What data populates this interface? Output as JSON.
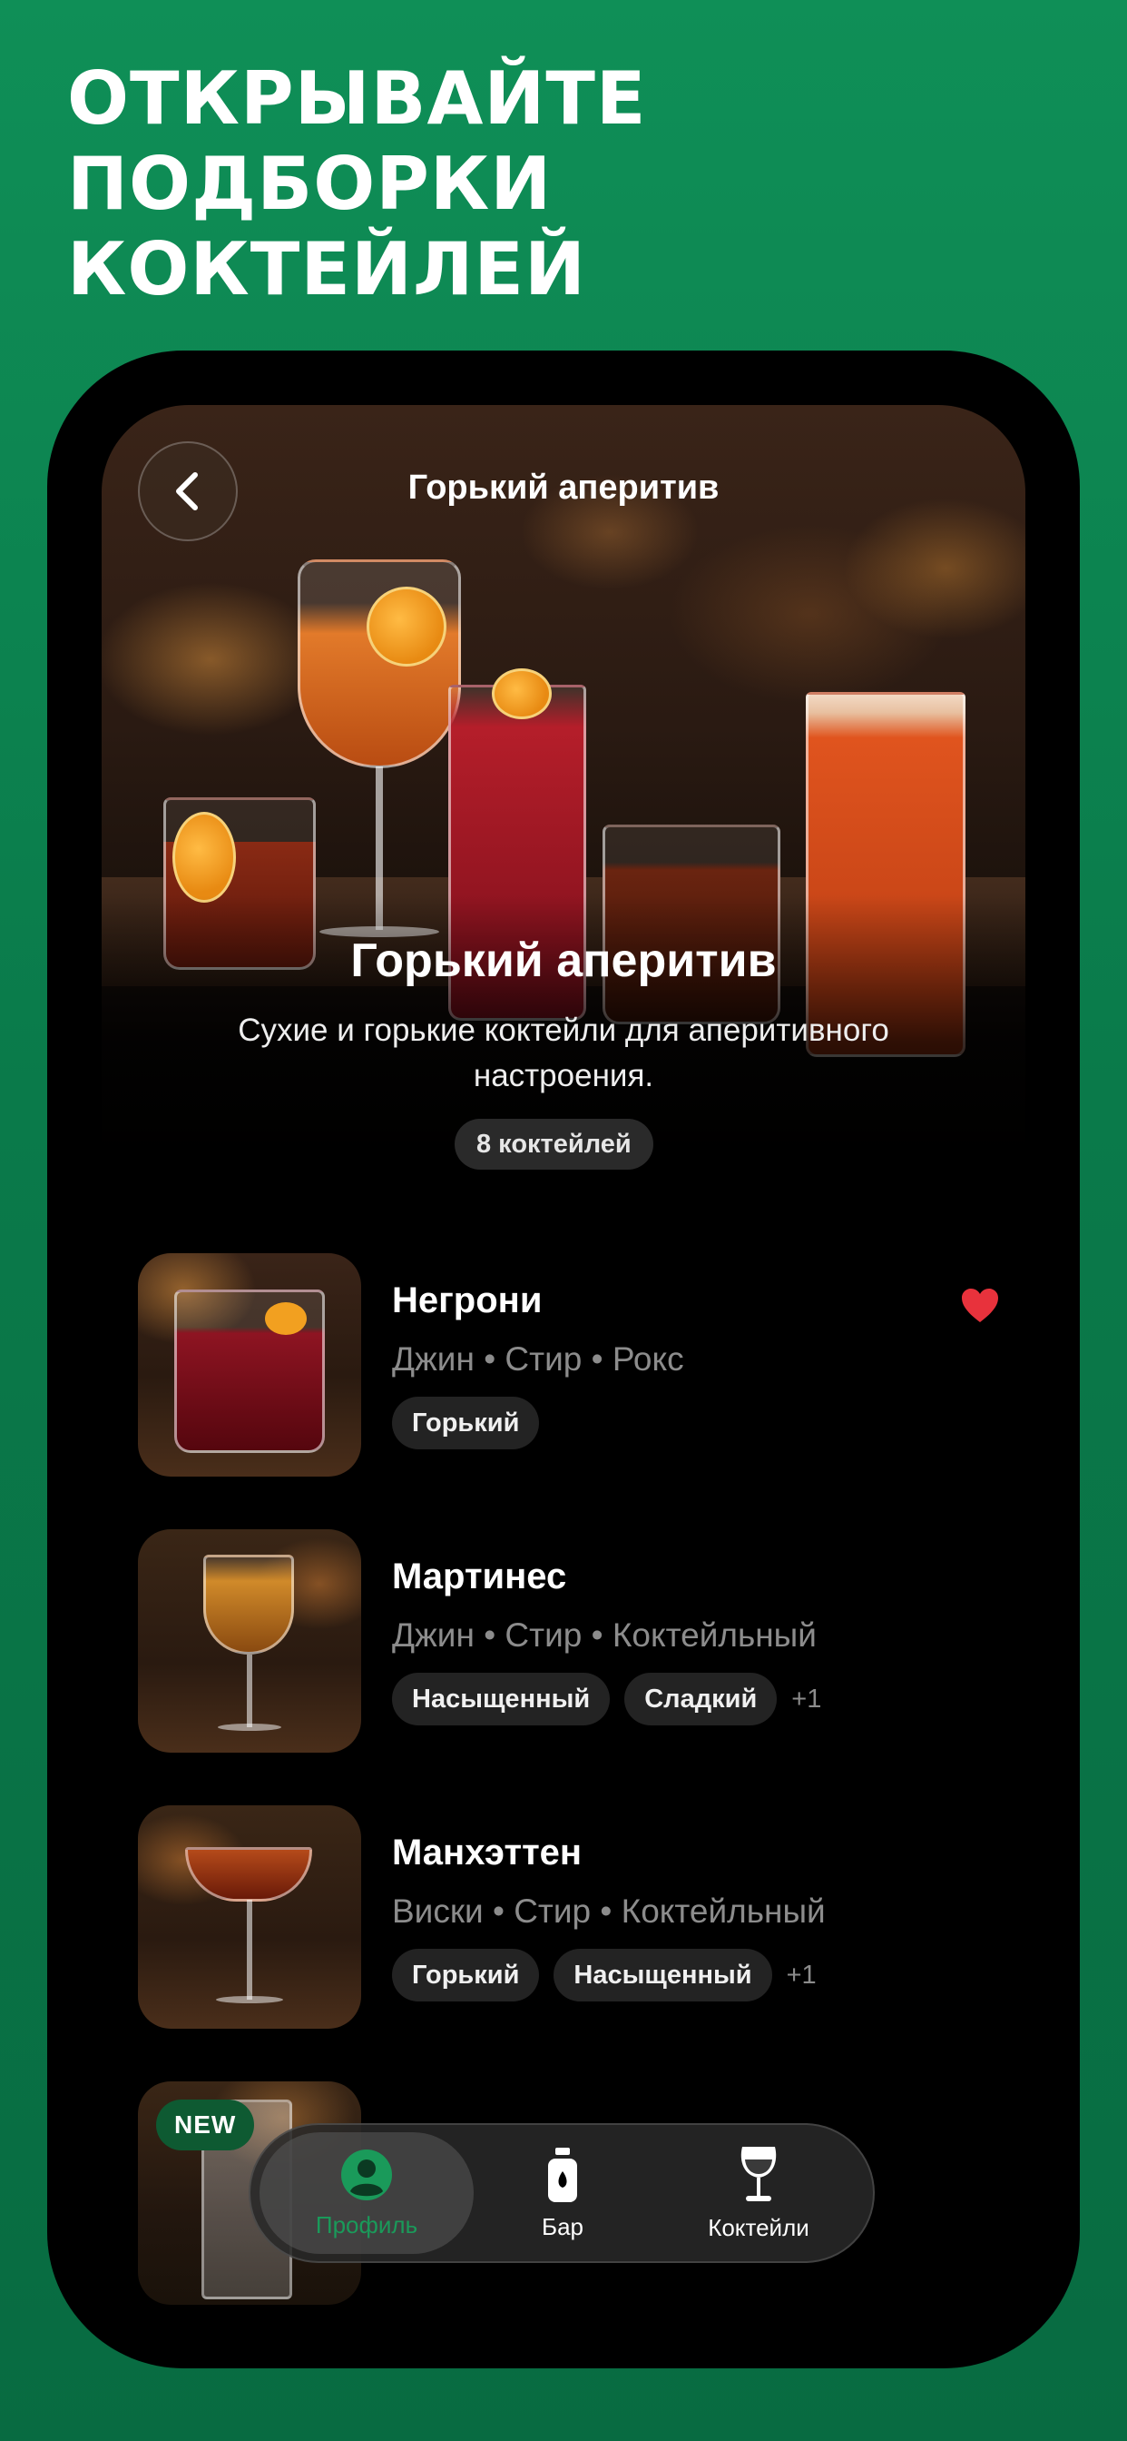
{
  "promo": {
    "headline_line1": "ОТКРЫВАЙТЕ ПОДБОРКИ",
    "headline_line2": "КОКТЕЙЛЕЙ"
  },
  "header": {
    "title": "Горький аперитив",
    "back_icon": "chevron-left-icon"
  },
  "collection": {
    "title": "Горький аперитив",
    "description": "Сухие и горькие коктейли для аперитивного настроения.",
    "count_label": "8 коктейлей"
  },
  "cocktails": [
    {
      "name": "Негрони",
      "meta": "Джин • Стир • Рокс",
      "tags": [
        "Горький"
      ],
      "more": "",
      "favorite": true,
      "is_new": false
    },
    {
      "name": "Мартинес",
      "meta": "Джин • Стир • Коктейльный",
      "tags": [
        "Насыщенный",
        "Сладкий"
      ],
      "more": "+1",
      "favorite": false,
      "is_new": false
    },
    {
      "name": "Манхэттен",
      "meta": "Виски • Стир • Коктейльный",
      "tags": [
        "Горький",
        "Насыщенный"
      ],
      "more": "+1",
      "favorite": false,
      "is_new": false
    },
    {
      "name": "",
      "meta": "",
      "tags": [],
      "more": "",
      "favorite": false,
      "is_new": true,
      "new_label": "NEW"
    }
  ],
  "tabbar": {
    "tabs": [
      {
        "label": "Профиль",
        "icon": "profile-icon",
        "active": true
      },
      {
        "label": "Бар",
        "icon": "bottle-icon",
        "active": false
      },
      {
        "label": "Коктейли",
        "icon": "wine-glass-icon",
        "active": false
      }
    ]
  },
  "colors": {
    "background": "#0a7a4a",
    "accent": "#1a9a5a",
    "heart": "#e8323c",
    "new_badge": "#0e5a32"
  }
}
